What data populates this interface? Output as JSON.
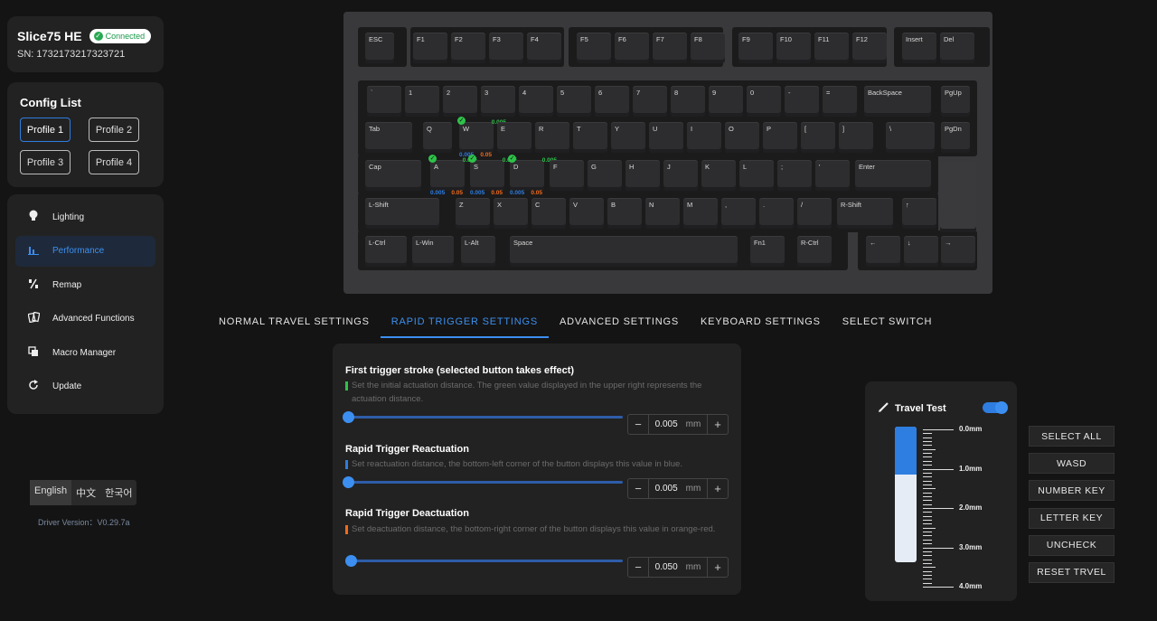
{
  "device": {
    "name": "Slice75 HE",
    "status": "Connected",
    "serial": "SN: 1732173217323721"
  },
  "config": {
    "title": "Config List",
    "profiles": [
      "Profile 1",
      "Profile 2",
      "Profile 3",
      "Profile 4"
    ],
    "active_profile": "Profile 1"
  },
  "nav": {
    "items": [
      {
        "label": "Lighting",
        "icon": "bulb-icon"
      },
      {
        "label": "Performance",
        "icon": "bar-chart-icon"
      },
      {
        "label": "Remap",
        "icon": "remap-icon"
      },
      {
        "label": "Advanced Functions",
        "icon": "cards-icon"
      },
      {
        "label": "Macro Manager",
        "icon": "macro-icon"
      },
      {
        "label": "Update",
        "icon": "refresh-icon"
      }
    ],
    "active": "Performance"
  },
  "languages": [
    "English",
    "中文",
    "한국어"
  ],
  "active_language": "English",
  "driver_version": "Driver Version：V0.29.7a",
  "keyboard": {
    "rows": [
      [
        "ESC",
        "F1",
        "F2",
        "F3",
        "F4",
        "F5",
        "F6",
        "F7",
        "F8",
        "F9",
        "F10",
        "F11",
        "F12",
        "Insert",
        "Del"
      ],
      [
        "`",
        "1",
        "2",
        "3",
        "4",
        "5",
        "6",
        "7",
        "8",
        "9",
        "0",
        "-",
        "=",
        "BackSpace",
        "PgUp"
      ],
      [
        "Tab",
        "Q",
        "W",
        "E",
        "R",
        "T",
        "Y",
        "U",
        "I",
        "O",
        "P",
        "[",
        "]",
        "\\",
        "PgDn"
      ],
      [
        "Cap",
        "A",
        "S",
        "D",
        "F",
        "G",
        "H",
        "J",
        "K",
        "L",
        ";",
        "'",
        "Enter"
      ],
      [
        "L-Shift",
        "Z",
        "X",
        "C",
        "V",
        "B",
        "N",
        "M",
        ",",
        ".",
        "/",
        "R-Shift",
        "↑"
      ],
      [
        "L-Ctrl",
        "L-Win",
        "L-Alt",
        "Space",
        "Fn1",
        "R-Ctrl",
        "←",
        "↓",
        "→"
      ]
    ],
    "selected_keys": [
      {
        "key": "W",
        "actuation": "0.005",
        "reactuation": "0.005",
        "deactuation": "0.05"
      },
      {
        "key": "A",
        "actuation": "0.005",
        "reactuation": "0.005",
        "deactuation": "0.05"
      },
      {
        "key": "S",
        "actuation": "0.005",
        "reactuation": "0.005",
        "deactuation": "0.05"
      },
      {
        "key": "D",
        "actuation": "0.005",
        "reactuation": "0.005",
        "deactuation": "0.05"
      }
    ]
  },
  "tabs": [
    "NORMAL TRAVEL SETTINGS",
    "RAPID TRIGGER SETTINGS",
    "ADVANCED SETTINGS",
    "KEYBOARD SETTINGS",
    "SELECT SWITCH"
  ],
  "active_tab": "RAPID TRIGGER SETTINGS",
  "settings": {
    "first_trigger": {
      "title": "First trigger stroke (selected button takes effect)",
      "desc": "Set the initial actuation distance. The green value displayed in the upper right represents the actuation distance.",
      "value": "0.005",
      "unit": "mm",
      "minus": "−",
      "plus": "+",
      "fraction": 0.0
    },
    "reactuation": {
      "title": "Rapid Trigger Reactuation",
      "desc": "Set reactuation distance, the bottom-left corner of the button displays this value in blue.",
      "value": "0.005",
      "unit": "mm",
      "minus": "−",
      "plus": "+",
      "fraction": 0.0
    },
    "deactuation": {
      "title": "Rapid Trigger Deactuation",
      "desc": "Set deactuation distance, the bottom-right corner of the button displays this value in orange-red.",
      "value": "0.050",
      "unit": "mm",
      "minus": "−",
      "plus": "+",
      "fraction": 0.01
    }
  },
  "travel_test": {
    "title": "Travel Test",
    "enabled": true,
    "level_fraction": 0.35,
    "scale_labels": [
      "0.0mm",
      "1.0mm",
      "2.0mm",
      "3.0mm",
      "4.0mm"
    ]
  },
  "quick_select": [
    "SELECT ALL",
    "WASD",
    "NUMBER KEY",
    "LETTER KEY",
    "UNCHECK",
    "RESET TRVEL"
  ],
  "colors": {
    "accent": "#3c8ff0",
    "green": "#2fc24a",
    "blue": "#2e7de0",
    "orange": "#f06a1a"
  }
}
